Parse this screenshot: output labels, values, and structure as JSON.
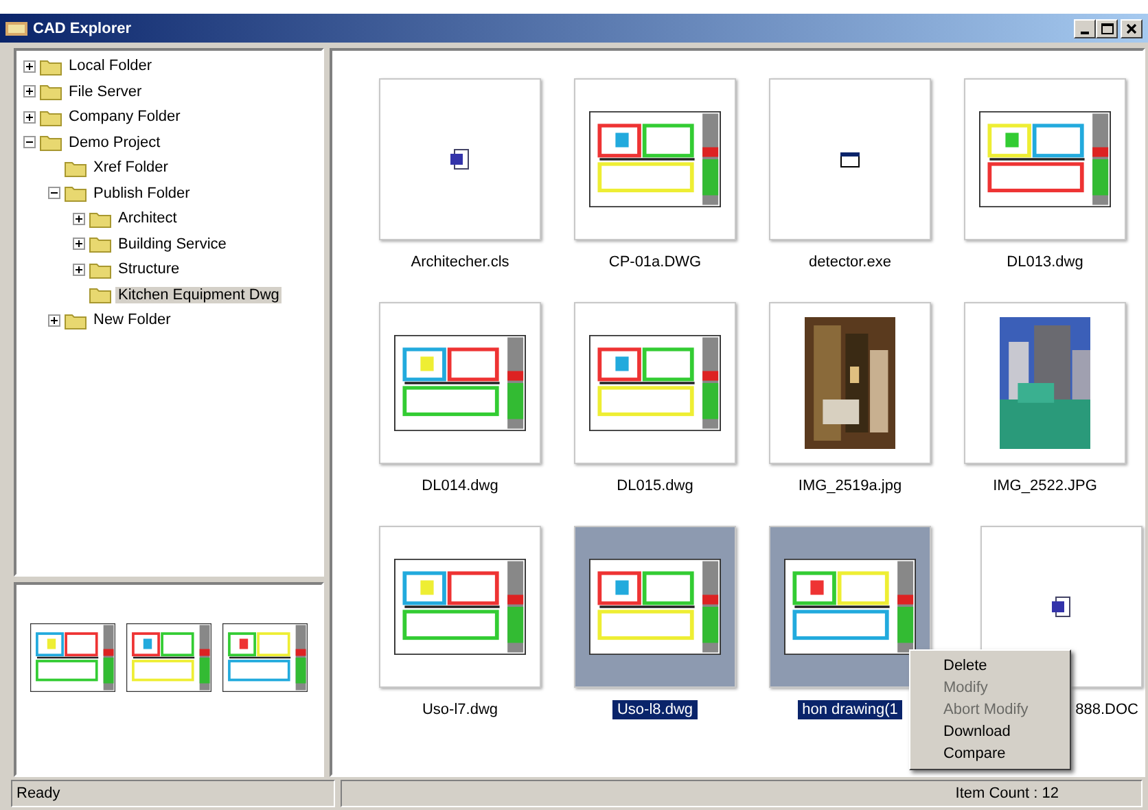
{
  "window": {
    "title": "CAD Explorer"
  },
  "tree": [
    {
      "label": "Local Folder",
      "expandable": true,
      "expanded": false,
      "selected": false
    },
    {
      "label": "File Server",
      "expandable": true,
      "expanded": false,
      "selected": false
    },
    {
      "label": "Company Folder",
      "expandable": true,
      "expanded": false,
      "selected": false
    },
    {
      "label": "Demo Project",
      "expandable": true,
      "expanded": true,
      "selected": false,
      "children": [
        {
          "label": "Xref Folder",
          "expandable": false,
          "expanded": false,
          "selected": false
        },
        {
          "label": "Publish Folder",
          "expandable": true,
          "expanded": true,
          "selected": false,
          "children": [
            {
              "label": "Architect",
              "expandable": true,
              "expanded": false,
              "selected": false
            },
            {
              "label": "Building Service",
              "expandable": true,
              "expanded": false,
              "selected": false
            },
            {
              "label": "Structure",
              "expandable": true,
              "expanded": false,
              "selected": false
            },
            {
              "label": "Kitchen Equipment Dwg",
              "expandable": false,
              "expanded": false,
              "selected": true
            }
          ]
        },
        {
          "label": "New Folder",
          "expandable": true,
          "expanded": false,
          "selected": false
        }
      ]
    }
  ],
  "files": [
    {
      "name": "Architecher.cls",
      "kind": "file",
      "selected": false
    },
    {
      "name": "CP-01a.DWG",
      "kind": "drawing",
      "selected": false
    },
    {
      "name": "detector.exe",
      "kind": "app",
      "selected": false
    },
    {
      "name": "DL013.dwg",
      "kind": "drawing",
      "selected": false
    },
    {
      "name": "DL014.dwg",
      "kind": "drawing",
      "selected": false
    },
    {
      "name": "DL015.dwg",
      "kind": "drawing",
      "selected": false
    },
    {
      "name": "IMG_2519a.jpg",
      "selected": false
    },
    {
      "name": "IMG_2522.JPG",
      "selected": false
    },
    {
      "name": "Uso-l7.dwg",
      "kind": "drawing",
      "selected": false
    },
    {
      "name": "Uso-l8.dwg",
      "kind": "drawing",
      "selected": true
    },
    {
      "name": "hon drawing(1",
      "kind": "drawing",
      "selected": true
    },
    {
      "name": "888.DOC",
      "kind": "file",
      "selected": false
    }
  ],
  "context_menu": [
    {
      "label": "Delete",
      "disabled": false
    },
    {
      "label": "Modify",
      "disabled": true
    },
    {
      "label": "Abort Modify",
      "disabled": true
    },
    {
      "label": "Download",
      "disabled": false
    },
    {
      "label": "Compare",
      "disabled": false
    }
  ],
  "status_bar": {
    "left": "Ready",
    "right": "Item Count : 12"
  }
}
